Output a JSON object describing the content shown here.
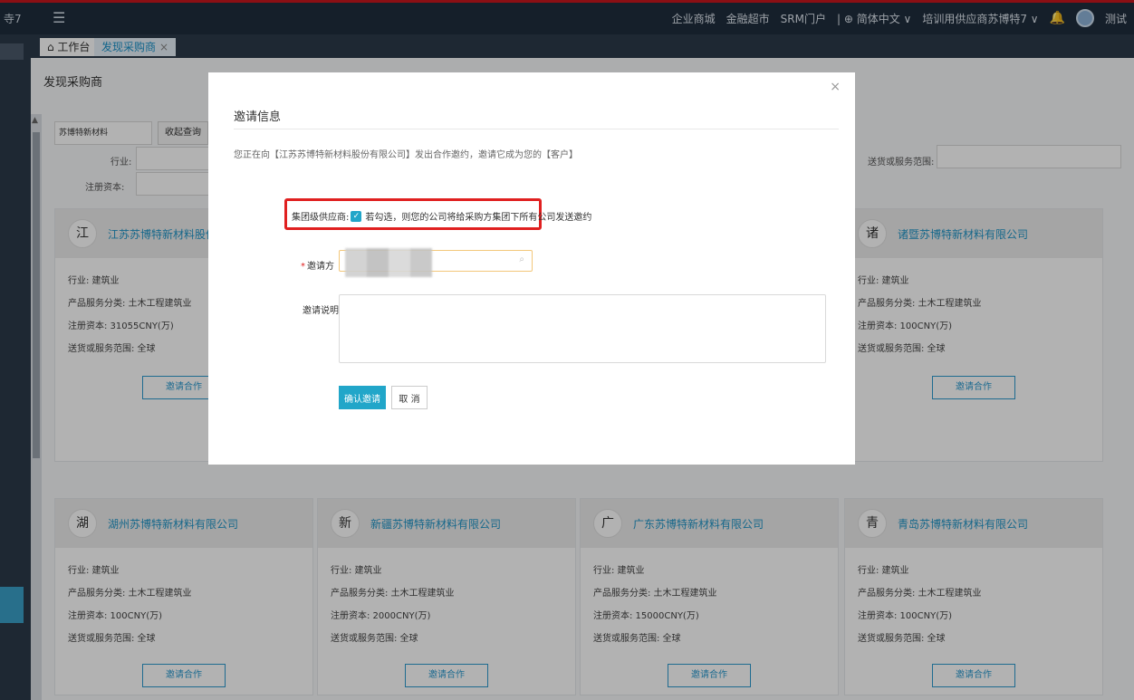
{
  "topbar": {
    "left_fragment": "寺7",
    "links": [
      "企业商城",
      "金融超市",
      "SRM门户",
      "| ⊕ 简体中文 ∨",
      "培训用供应商苏博特7 ∨"
    ],
    "user_fragment": "测试"
  },
  "tabs": [
    {
      "label": "⌂ 工作台"
    },
    {
      "label": "发现采购商",
      "close": "×"
    }
  ],
  "page": {
    "title": "发现采购商"
  },
  "search": {
    "keyword": "苏博特新材料",
    "collapse_label": "收起查询",
    "industry_label": "行业:",
    "capital_label": "注册资本:",
    "scope_label": "送货或服务范围:"
  },
  "cards": [
    {
      "badge": "江",
      "name": "江苏苏博特新材料股份有限公司",
      "industry": "行业: 建筑业",
      "category": "产品服务分类: 土木工程建筑业",
      "capital": "注册资本: 31055CNY(万)",
      "scope": "送货或服务范围: 全球",
      "button": "邀请合作"
    },
    {
      "badge": "诸",
      "name": "诸暨苏博特新材料有限公司",
      "industry": "行业: 建筑业",
      "category": "产品服务分类: 土木工程建筑业",
      "capital": "注册资本: 100CNY(万)",
      "scope": "送货或服务范围: 全球",
      "button": "邀请合作"
    },
    {
      "badge": "湖",
      "name": "湖州苏博特新材料有限公司",
      "industry": "行业: 建筑业",
      "category": "产品服务分类: 土木工程建筑业",
      "capital": "注册资本: 100CNY(万)",
      "scope": "送货或服务范围: 全球",
      "button": "邀请合作"
    },
    {
      "badge": "新",
      "name": "新疆苏博特新材料有限公司",
      "industry": "行业: 建筑业",
      "category": "产品服务分类: 土木工程建筑业",
      "capital": "注册资本: 2000CNY(万)",
      "scope": "送货或服务范围: 全球",
      "button": "邀请合作"
    },
    {
      "badge": "广",
      "name": "广东苏博特新材料有限公司",
      "industry": "行业: 建筑业",
      "category": "产品服务分类: 土木工程建筑业",
      "capital": "注册资本: 15000CNY(万)",
      "scope": "送货或服务范围: 全球",
      "button": "邀请合作"
    },
    {
      "badge": "青",
      "name": "青岛苏博特新材料有限公司",
      "industry": "行业: 建筑业",
      "category": "产品服务分类: 土木工程建筑业",
      "capital": "注册资本: 100CNY(万)",
      "scope": "送货或服务范围: 全球",
      "button": "邀请合作"
    }
  ],
  "modal": {
    "close": "×",
    "title": "邀请信息",
    "notice": "您正在向【江苏苏博特新材料股份有限公司】发出合作邀约，邀请它成为您的【客户】",
    "group_label": "集团级供应商:",
    "checkbox_mark": "✓",
    "group_hint": "若勾选，则您的公司将给采购方集团下所有公司发送邀约",
    "inviter_required": "*",
    "inviter_label": "邀请方",
    "inviter_placeholder": "",
    "desc_label": "邀请说明:",
    "confirm_label": "确认邀请",
    "cancel_label": "取 消"
  },
  "colors": {
    "accent": "#21a6c9",
    "highlight_border": "#e02020",
    "topbar_bg": "#1f2d3d"
  },
  "icons": [
    "menu-icon",
    "home-icon",
    "bell-icon",
    "avatar",
    "search-icon",
    "close-icon",
    "checkbox-checked-icon",
    "scroll-up-icon"
  ]
}
